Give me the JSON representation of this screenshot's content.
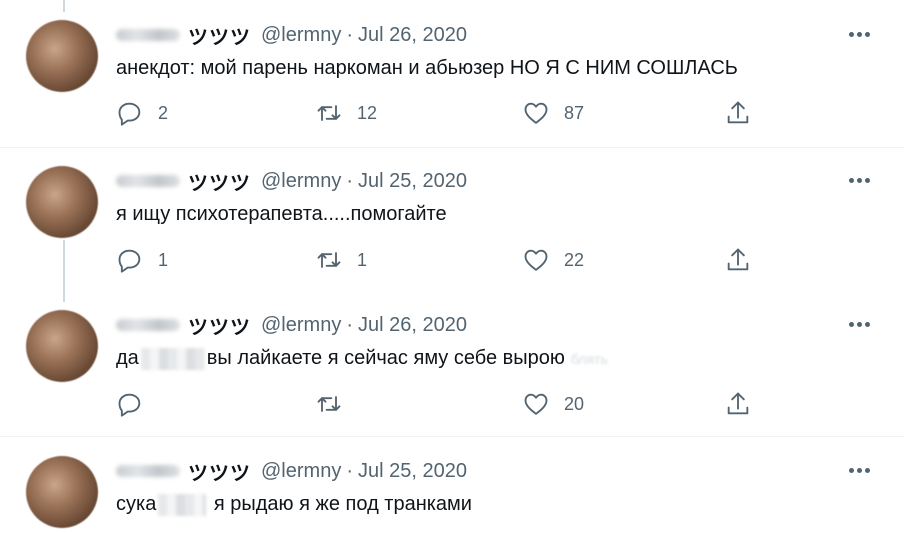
{
  "tweets": [
    {
      "kana": "ツツツ",
      "handle": "@lermny",
      "date": "Jul 26, 2020",
      "text": "анекдот: мой парень наркоман и абьюзер НО Я С НИМ СОШЛАСЬ",
      "reply_count": "2",
      "retweet_count": "12",
      "like_count": "87"
    },
    {
      "kana": "ツツツ",
      "handle": "@lermny",
      "date": "Jul 25, 2020",
      "text": "я ищу психотерапевта.....помогайте",
      "reply_count": "1",
      "retweet_count": "1",
      "like_count": "22"
    },
    {
      "kana": "ツツツ",
      "handle": "@lermny",
      "date": "Jul 26, 2020",
      "text_before": "да",
      "text_after": "вы лайкаете я сейчас яму себе вырою",
      "text_faded": "блять",
      "reply_count": "",
      "retweet_count": "",
      "like_count": "20"
    },
    {
      "kana": "ツツツ",
      "handle": "@lermny",
      "date": "Jul 25, 2020",
      "text_before": "сука",
      "text_after": "я рыдаю я же под транками"
    }
  ],
  "separator": "·",
  "icons": [
    "reply-icon",
    "retweet-icon",
    "like-icon",
    "share-icon",
    "more-icon"
  ],
  "colors": {
    "text": "#0f1419",
    "secondary": "#536471",
    "divider": "#eff3f4",
    "thread_line": "#cfd9de"
  }
}
